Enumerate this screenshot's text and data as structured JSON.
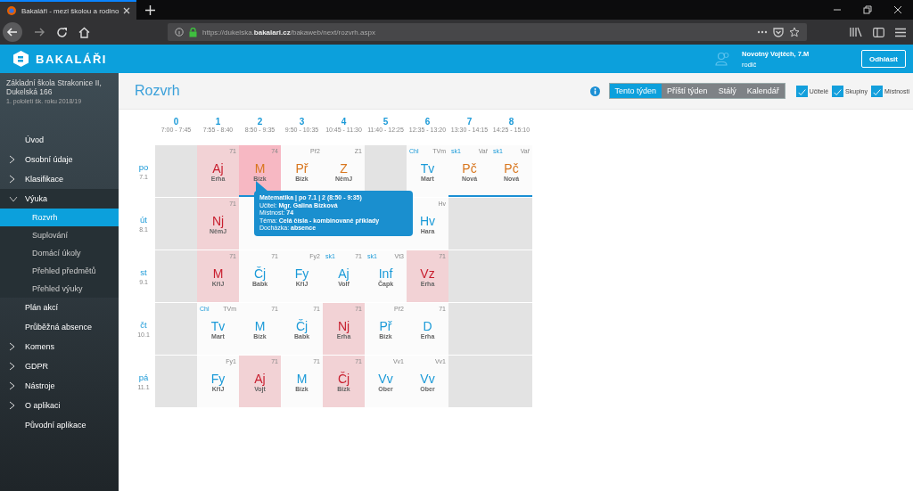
{
  "browser": {
    "tab_title": "Bakaláři - mezi školou a rodino",
    "url": "https://dukelska.**bakalari.cz**/bakaweb/next/rozvrh.aspx"
  },
  "header": {
    "logo": "BAKALÁŘI",
    "user_name": "Novotný Vojtěch, 7.M",
    "user_role": "rodič",
    "logout": "Odhlásit"
  },
  "sidebar": {
    "school": "Základní škola Strakonice II, Dukelská 166",
    "term": "1. pololetí šk. roku 2018/19",
    "items": [
      {
        "label": "Úvod",
        "kind": "link",
        "selected": false
      },
      {
        "label": "Osobní údaje",
        "kind": "group",
        "expanded": false,
        "selected": false
      },
      {
        "label": "Klasifikace",
        "kind": "group",
        "expanded": false,
        "selected": false
      },
      {
        "label": "Výuka",
        "kind": "group",
        "expanded": true,
        "selected": false,
        "children": [
          {
            "label": "Rozvrh",
            "selected": true
          },
          {
            "label": "Suplování",
            "selected": false
          },
          {
            "label": "Domácí úkoly",
            "selected": false
          },
          {
            "label": "Přehled předmětů",
            "selected": false
          },
          {
            "label": "Přehled výuky",
            "selected": false
          }
        ]
      },
      {
        "label": "Plán akcí",
        "kind": "link",
        "selected": false
      },
      {
        "label": "Průběžná absence",
        "kind": "link",
        "selected": false
      },
      {
        "label": "Komens",
        "kind": "group",
        "expanded": false,
        "selected": false
      },
      {
        "label": "GDPR",
        "kind": "group",
        "expanded": false,
        "selected": false
      },
      {
        "label": "Nástroje",
        "kind": "group",
        "expanded": false,
        "selected": false
      },
      {
        "label": "O aplikaci",
        "kind": "group",
        "expanded": false,
        "selected": false
      },
      {
        "label": "Původní aplikace",
        "kind": "link",
        "selected": false
      }
    ]
  },
  "page": {
    "title": "Rozvrh",
    "views": [
      {
        "label": "Tento týden",
        "selected": true
      },
      {
        "label": "Příští týden",
        "selected": false
      },
      {
        "label": "Stálý",
        "selected": false
      },
      {
        "label": "Kalendář",
        "selected": false
      }
    ],
    "filters": [
      {
        "label": "Učitelé",
        "checked": true
      },
      {
        "label": "Skupiny",
        "checked": true
      },
      {
        "label": "Místnosti",
        "checked": true
      }
    ]
  },
  "timetable": {
    "periods": [
      {
        "number": "0",
        "time": "7:00 - 7:45"
      },
      {
        "number": "1",
        "time": "7:55 - 8:40"
      },
      {
        "number": "2",
        "time": "8:50 - 9:35"
      },
      {
        "number": "3",
        "time": "9:50 - 10:35"
      },
      {
        "number": "4",
        "time": "10:45 - 11:30"
      },
      {
        "number": "5",
        "time": "11:40 - 12:25"
      },
      {
        "number": "6",
        "time": "12:35 - 13:20"
      },
      {
        "number": "7",
        "time": "13:30 - 14:15"
      },
      {
        "number": "8",
        "time": "14:25 - 15:10"
      }
    ],
    "days": [
      {
        "day": "po",
        "date": "7.1",
        "cells": [
          {
            "kind": "empty"
          },
          {
            "kind": "lesson",
            "subject": "Aj",
            "teacher": "Erha",
            "room": "71",
            "absence": true,
            "changed": false,
            "underlined": false,
            "selected": false
          },
          {
            "kind": "lesson",
            "subject": "M",
            "teacher": "Bízk",
            "room": "74",
            "absence": true,
            "changed": true,
            "underlined": true,
            "selected": true
          },
          {
            "kind": "lesson",
            "subject": "Př",
            "teacher": "Bízk",
            "room": "Př2",
            "absence": false,
            "changed": true,
            "underlined": false,
            "selected": false
          },
          {
            "kind": "lesson",
            "subject": "Z",
            "teacher": "NěmJ",
            "room": "Z1",
            "absence": false,
            "changed": true,
            "underlined": false,
            "selected": false
          },
          {
            "kind": "empty"
          },
          {
            "kind": "lesson",
            "subject": "Tv",
            "teacher": "Mart",
            "room": "TVm",
            "group": "Chl",
            "absence": false,
            "changed": false,
            "underlined": false,
            "selected": false
          },
          {
            "kind": "lesson",
            "subject": "Pč",
            "teacher": "Nová",
            "room": "Vař",
            "group": "sk1",
            "absence": false,
            "changed": true,
            "underlined": true,
            "selected": false
          },
          {
            "kind": "lesson",
            "subject": "Pč",
            "teacher": "Nová",
            "room": "Vař",
            "group": "sk1",
            "absence": false,
            "changed": true,
            "underlined": true,
            "selected": false
          }
        ]
      },
      {
        "day": "út",
        "date": "8.1",
        "cells": [
          {
            "kind": "empty"
          },
          {
            "kind": "lesson",
            "subject": "Nj",
            "teacher": "NěmJ",
            "room": "71",
            "absence": true,
            "changed": false,
            "underlined": false,
            "selected": false
          },
          {
            "kind": "covered"
          },
          {
            "kind": "covered"
          },
          {
            "kind": "covered"
          },
          {
            "kind": "covered"
          },
          {
            "kind": "lesson",
            "subject": "Hv",
            "teacher": "Hara",
            "room": "Hv",
            "absence": false,
            "changed": false,
            "underlined": false,
            "selected": false
          },
          {
            "kind": "empty"
          },
          {
            "kind": "empty"
          }
        ]
      },
      {
        "day": "st",
        "date": "9.1",
        "cells": [
          {
            "kind": "empty"
          },
          {
            "kind": "lesson",
            "subject": "M",
            "teacher": "KřiJ",
            "room": "71",
            "absence": true,
            "changed": false,
            "underlined": false,
            "selected": false
          },
          {
            "kind": "lesson",
            "subject": "Čj",
            "teacher": "Babk",
            "room": "71",
            "absence": false,
            "changed": false,
            "underlined": false,
            "selected": false
          },
          {
            "kind": "lesson",
            "subject": "Fy",
            "teacher": "KřiJ",
            "room": "Fy2",
            "absence": false,
            "changed": false,
            "underlined": false,
            "selected": false
          },
          {
            "kind": "lesson",
            "subject": "Aj",
            "teacher": "Volf",
            "room": "71",
            "group": "sk1",
            "absence": false,
            "changed": false,
            "underlined": false,
            "selected": false
          },
          {
            "kind": "lesson",
            "subject": "Inf",
            "teacher": "Čapk",
            "room": "Vt3",
            "group": "sk1",
            "absence": false,
            "changed": false,
            "underlined": false,
            "selected": false
          },
          {
            "kind": "lesson",
            "subject": "Vz",
            "teacher": "Erha",
            "room": "71",
            "absence": true,
            "changed": false,
            "underlined": false,
            "selected": false
          },
          {
            "kind": "empty"
          },
          {
            "kind": "empty"
          }
        ]
      },
      {
        "day": "čt",
        "date": "10.1",
        "cells": [
          {
            "kind": "empty"
          },
          {
            "kind": "lesson",
            "subject": "Tv",
            "teacher": "Mart",
            "room": "TVm",
            "group": "Chl",
            "absence": false,
            "changed": false,
            "underlined": false,
            "selected": false
          },
          {
            "kind": "lesson",
            "subject": "M",
            "teacher": "Bízk",
            "room": "71",
            "absence": false,
            "changed": false,
            "underlined": false,
            "selected": false
          },
          {
            "kind": "lesson",
            "subject": "Čj",
            "teacher": "Babk",
            "room": "71",
            "absence": false,
            "changed": false,
            "underlined": false,
            "selected": false
          },
          {
            "kind": "lesson",
            "subject": "Nj",
            "teacher": "Erha",
            "room": "71",
            "absence": true,
            "changed": false,
            "underlined": false,
            "selected": false
          },
          {
            "kind": "lesson",
            "subject": "Př",
            "teacher": "Bízk",
            "room": "Př2",
            "absence": false,
            "changed": false,
            "underlined": false,
            "selected": false
          },
          {
            "kind": "lesson",
            "subject": "D",
            "teacher": "Erha",
            "room": "71",
            "absence": false,
            "changed": false,
            "underlined": false,
            "selected": false
          },
          {
            "kind": "empty"
          },
          {
            "kind": "empty"
          }
        ]
      },
      {
        "day": "pá",
        "date": "11.1",
        "cells": [
          {
            "kind": "empty"
          },
          {
            "kind": "lesson",
            "subject": "Fy",
            "teacher": "KřiJ",
            "room": "Fy1",
            "absence": false,
            "changed": false,
            "underlined": false,
            "selected": false
          },
          {
            "kind": "lesson",
            "subject": "Aj",
            "teacher": "Vojt",
            "room": "71",
            "absence": true,
            "changed": false,
            "underlined": false,
            "selected": false
          },
          {
            "kind": "lesson",
            "subject": "M",
            "teacher": "Bízk",
            "room": "71",
            "absence": false,
            "changed": false,
            "underlined": false,
            "selected": false
          },
          {
            "kind": "lesson",
            "subject": "Čj",
            "teacher": "Bízk",
            "room": "71",
            "absence": true,
            "changed": false,
            "underlined": false,
            "selected": false
          },
          {
            "kind": "lesson",
            "subject": "Vv",
            "teacher": "Ober",
            "room": "Vv1",
            "absence": false,
            "changed": false,
            "underlined": false,
            "selected": false
          },
          {
            "kind": "lesson",
            "subject": "Vv",
            "teacher": "Ober",
            "room": "Vv1",
            "absence": false,
            "changed": false,
            "underlined": false,
            "selected": false
          },
          {
            "kind": "empty"
          },
          {
            "kind": "empty"
          }
        ]
      }
    ]
  },
  "tooltip": {
    "title": "Matematika | po 7.1 | 2 (8:50 - 9:35)",
    "lines": [
      "Učitel: **Mgr. Galina Bízková**",
      "Místnost: **74**",
      "Téma: **Celá čísla - kombinované příklady**",
      "Docházka: **absence**"
    ]
  }
}
